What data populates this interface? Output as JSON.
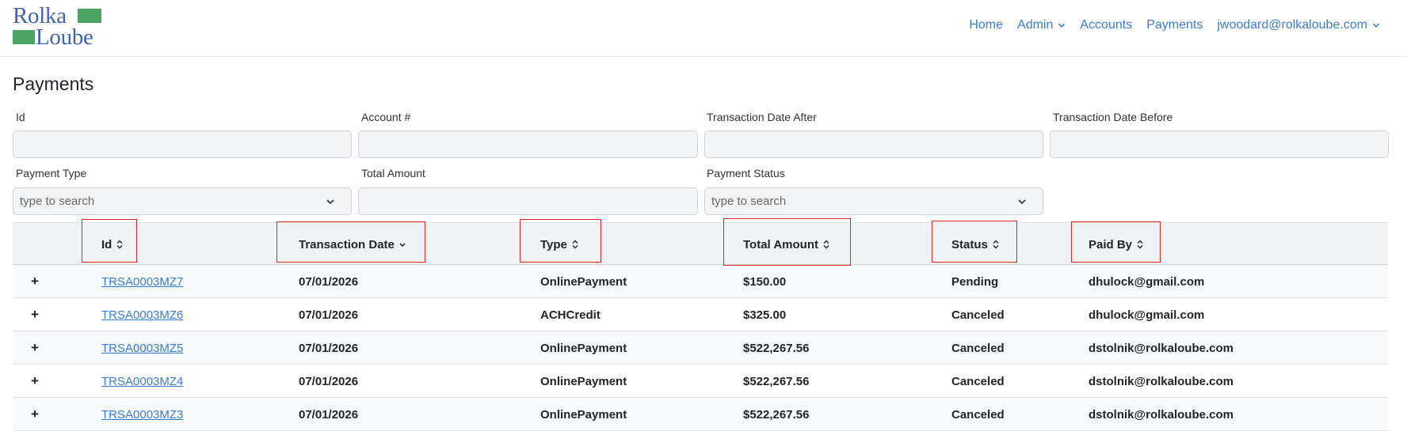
{
  "brand": {
    "line1": "Rolka",
    "line2": "Loube",
    "color": "#3d64b3",
    "accent": "#4aa564"
  },
  "nav": {
    "items": [
      {
        "label": "Home"
      },
      {
        "label": "Admin"
      },
      {
        "label": "Accounts"
      },
      {
        "label": "Payments"
      },
      {
        "label": "jwoodard@rolkaloube.com"
      }
    ]
  },
  "page": {
    "title": "Payments"
  },
  "filters": {
    "id": {
      "label": "Id",
      "value": ""
    },
    "account": {
      "label": "Account #",
      "value": ""
    },
    "date_after": {
      "label": "Transaction Date After",
      "value": ""
    },
    "date_before": {
      "label": "Transaction Date Before",
      "value": ""
    },
    "payment_type": {
      "label": "Payment Type",
      "placeholder": "type to search"
    },
    "total_amount": {
      "label": "Total Amount",
      "value": ""
    },
    "payment_status": {
      "label": "Payment Status",
      "placeholder": "type to search"
    }
  },
  "table": {
    "columns": [
      "Id",
      "Transaction Date",
      "Type",
      "Total Amount",
      "Status",
      "Paid By"
    ],
    "expand_symbol": "+",
    "rows": [
      {
        "id": "TRSA0003MZ7",
        "date": "07/01/2026",
        "type": "OnlinePayment",
        "amount": "$150.00",
        "status": "Pending",
        "paid_by": "dhulock@gmail.com"
      },
      {
        "id": "TRSA0003MZ6",
        "date": "07/01/2026",
        "type": "ACHCredit",
        "amount": "$325.00",
        "status": "Canceled",
        "paid_by": "dhulock@gmail.com"
      },
      {
        "id": "TRSA0003MZ5",
        "date": "07/01/2026",
        "type": "OnlinePayment",
        "amount": "$522,267.56",
        "status": "Canceled",
        "paid_by": "dstolnik@rolkaloube.com"
      },
      {
        "id": "TRSA0003MZ4",
        "date": "07/01/2026",
        "type": "OnlinePayment",
        "amount": "$522,267.56",
        "status": "Canceled",
        "paid_by": "dstolnik@rolkaloube.com"
      },
      {
        "id": "TRSA0003MZ3",
        "date": "07/01/2026",
        "type": "OnlinePayment",
        "amount": "$522,267.56",
        "status": "Canceled",
        "paid_by": "dstolnik@rolkaloube.com"
      }
    ]
  }
}
